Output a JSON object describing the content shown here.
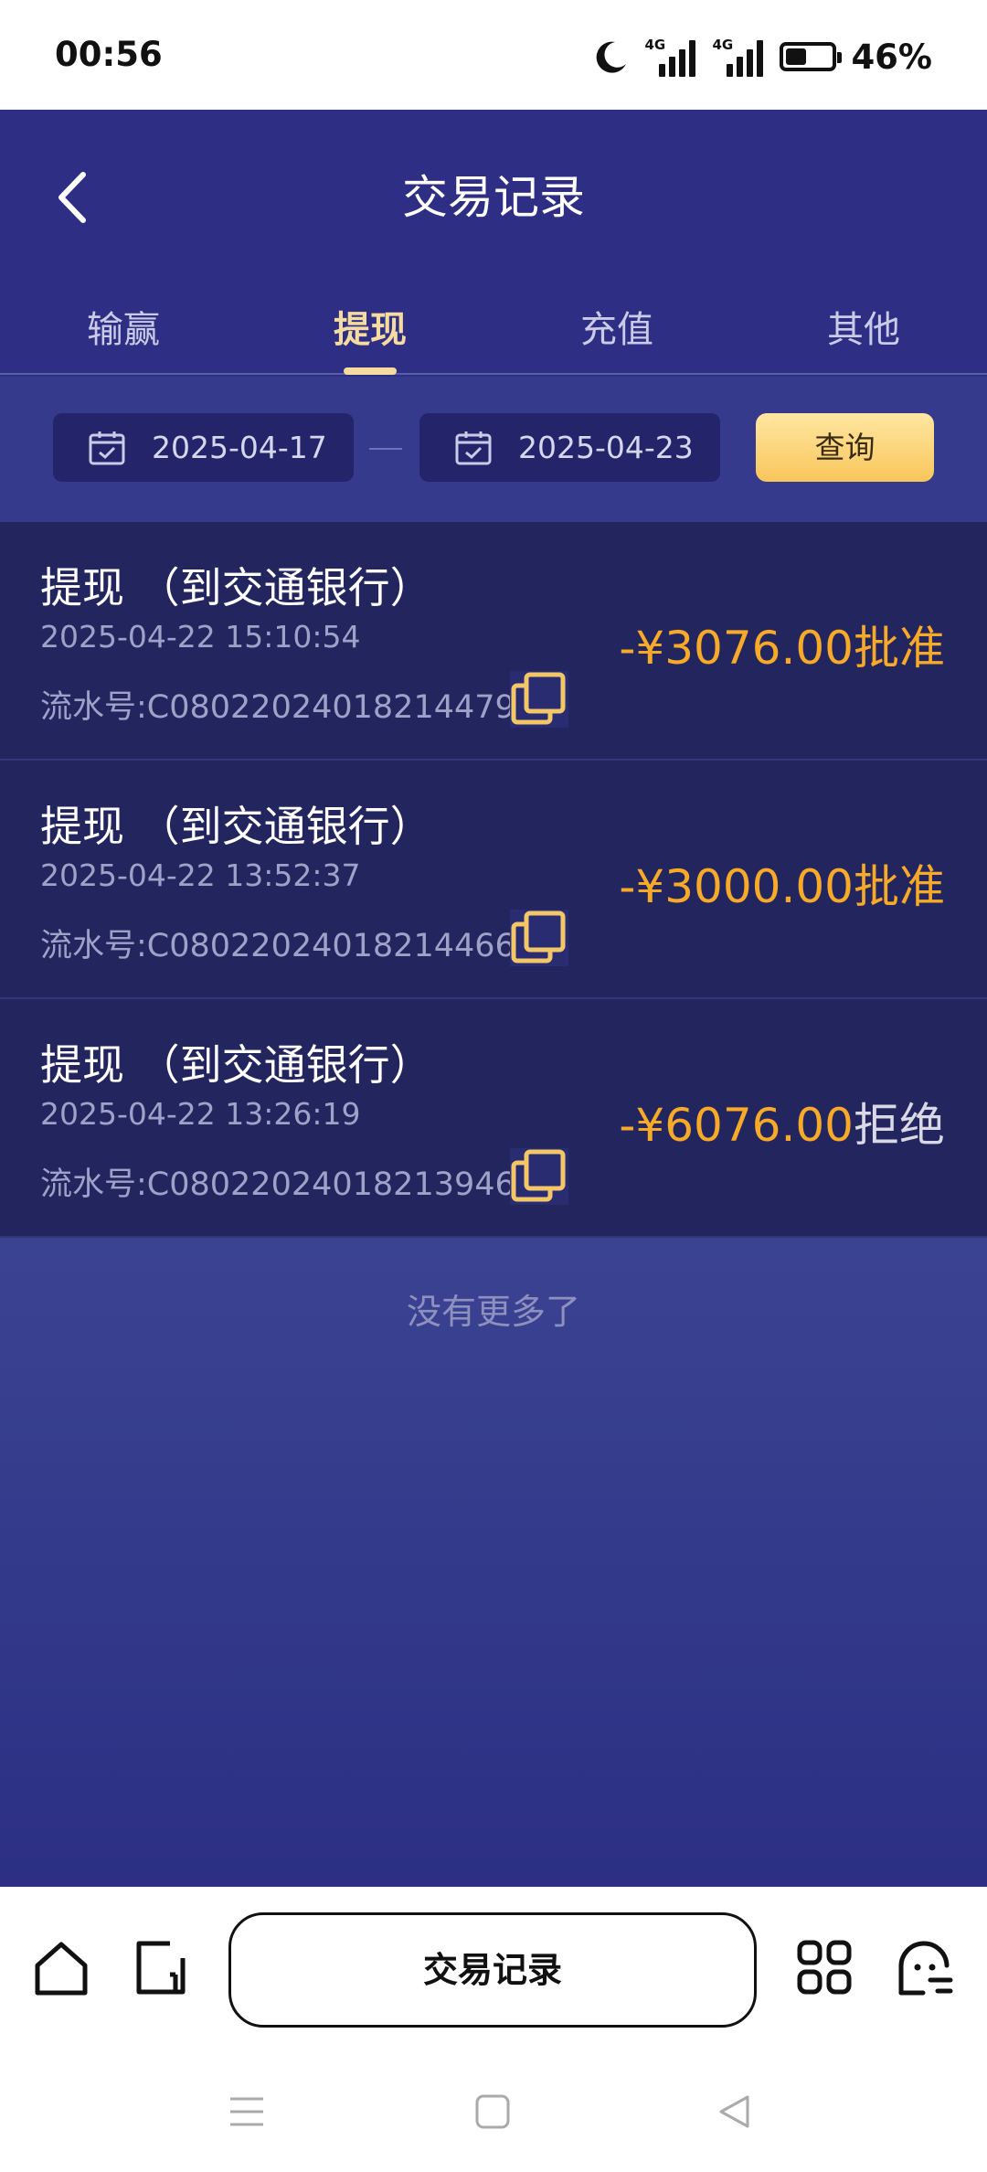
{
  "status_bar": {
    "time": "00:56",
    "signal1_tag": "4G",
    "signal2_tag": "4G",
    "battery_text": "46%",
    "battery_level": 0.46
  },
  "header": {
    "title": "交易记录",
    "back_icon": "chevron-left-icon"
  },
  "tabs": [
    {
      "label": "输赢",
      "active": false
    },
    {
      "label": "提现",
      "active": true
    },
    {
      "label": "充值",
      "active": false
    },
    {
      "label": "其他",
      "active": false
    }
  ],
  "filter": {
    "start_date": "2025-04-17",
    "end_date": "2025-04-23",
    "query_label": "查询",
    "calendar_icon": "calendar-check-icon"
  },
  "records": [
    {
      "title": "提现 （到交通银行）",
      "time": "2025-04-22 15:10:54",
      "serial": "流水号:C080220240182144795",
      "amount": "-¥3076.00",
      "status": "批准",
      "status_type": "approved"
    },
    {
      "title": "提现 （到交通银行）",
      "time": "2025-04-22 13:52:37",
      "serial": "流水号:C080220240182144666",
      "amount": "-¥3000.00",
      "status": "批准",
      "status_type": "approved"
    },
    {
      "title": "提现 （到交通银行）",
      "time": "2025-04-22 13:26:19",
      "serial": "流水号:C080220240182139464",
      "amount": "-¥6076.00",
      "status": "拒绝",
      "status_type": "rejected"
    }
  ],
  "no_more_text": "没有更多了",
  "bottom_nav": {
    "center_label": "交易记录",
    "icons": [
      "home-icon",
      "tab-switch-icon",
      "apps-grid-icon",
      "chat-bot-icon"
    ]
  },
  "colors": {
    "header_bg": "#2e2f84",
    "accent_gold": "#f6dba1",
    "amount_orange": "#f7a928",
    "row_bg": "#23255f"
  }
}
